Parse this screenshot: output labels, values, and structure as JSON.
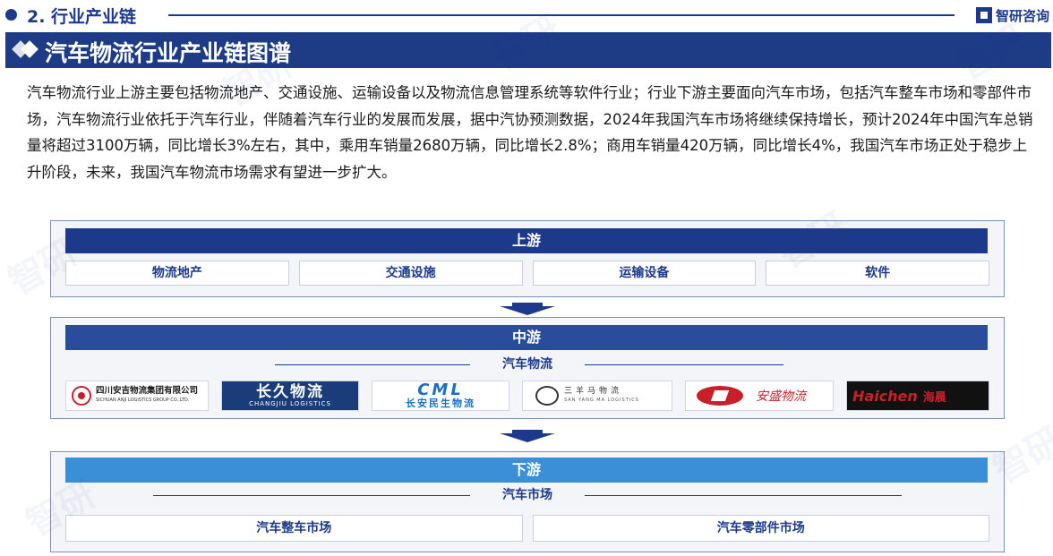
{
  "header": {
    "section_title": "2. 行业产业链",
    "brand_name": "智研咨询"
  },
  "title_bar": {
    "title": "汽车物流行业产业链图谱"
  },
  "intro": {
    "text": "汽车物流行业上游主要包括物流地产、交通设施、运输设备以及物流信息管理系统等软件行业；行业下游主要面向汽车市场，包括汽车整车市场和零部件市场，汽车物流行业依托于汽车行业，伴随着汽车行业的发展而发展，据中汽协预测数据，2024年我国汽车市场将继续保持增长，预计2024年中国汽车总销量将超过3100万辆，同比增长3%左右，其中，乘用车销量2680万辆，同比增长2.8%；商用车销量420万辆，同比增长4%，我国汽车市场正处于稳步上升阶段，未来，我国汽车物流市场需求有望进一步扩大。"
  },
  "upstream": {
    "label": "上游",
    "items": [
      "物流地产",
      "交通设施",
      "运输设备",
      "软件"
    ]
  },
  "midstream": {
    "label": "中游",
    "sub_label": "汽车物流",
    "logos": [
      {
        "name_cn": "四川安吉物流集团有限公司",
        "name_en": "SICHUAN ANJI LOGISTICS GROUP CO.,LTD."
      },
      {
        "name_cn": "长久物流",
        "name_en": "CHANGJIU LOGISTICS"
      },
      {
        "name_en": "CML",
        "name_cn": "长安民生物流"
      },
      {
        "name_cn": "三羊马物流",
        "name_en": "SAN YANG MA LOGISTICS"
      },
      {
        "name_cn": "安盛物流"
      },
      {
        "name_en": "Haichen",
        "name_cn": "海晨"
      }
    ]
  },
  "downstream": {
    "label": "下游",
    "sub_label": "汽车市场",
    "items": [
      "汽车整车市场",
      "汽车零部件市场"
    ]
  },
  "colors": {
    "primary": "#1d3a8a",
    "mid_bar": "#2a4d9b",
    "down_bar": "#3b8fd6",
    "panel_bg": "#f4f5f8",
    "logo_red": "#c8202a"
  }
}
